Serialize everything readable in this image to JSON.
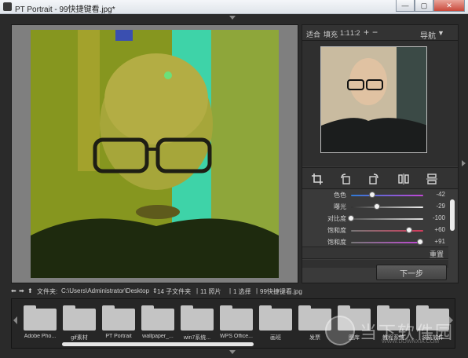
{
  "window": {
    "title": "PT Portrait - 99快捷键看.jpg*",
    "minimize_icon": "minimize-icon",
    "maximize_icon": "maximize-icon",
    "close_icon": "close-icon"
  },
  "zoom_bar": {
    "fit": "适合",
    "fill": "填充",
    "ratio1": "1:1",
    "ratio2": "1:2",
    "plus": "+",
    "minus": "−",
    "nav_label": "导航",
    "nav_toggle": "▼"
  },
  "tools": [
    "crop-icon",
    "rotate-left-icon",
    "rotate-right-icon",
    "flip-horizontal-icon",
    "flip-vertical-icon"
  ],
  "sliders": [
    {
      "label": "色色",
      "value": "-42",
      "fraction": 0.29,
      "track": "linear-gradient(90deg,#2e7bd6,#c247d6)"
    },
    {
      "label": "曝光",
      "value": "-29",
      "fraction": 0.36,
      "track": "linear-gradient(90deg,#333,#eee)"
    },
    {
      "label": "对比度",
      "value": "-100",
      "fraction": 0.0,
      "track": "linear-gradient(90deg,#555,#ddd)"
    },
    {
      "label": "饱和度",
      "value": "+60",
      "fraction": 0.8,
      "track": "linear-gradient(90deg,#777,#d33b5c)"
    },
    {
      "label": "饱和度",
      "value": "+91",
      "fraction": 0.955,
      "track": "linear-gradient(90deg,#777,#c247d6)"
    }
  ],
  "reset_label": "重置",
  "next_button": "下一步",
  "pathbar": {
    "folder_label": "文件夹:",
    "path": "C:\\Users\\Administrator\\Desktop",
    "sub_folders": "14 子文件夹",
    "photos": "11 照片",
    "selected": "1 选择",
    "file": "99快捷键看.jpg"
  },
  "folders": [
    {
      "name": "Adobe Pho..."
    },
    {
      "name": "gif素材"
    },
    {
      "name": "PT Portrait"
    },
    {
      "name": "wallpaper_..."
    },
    {
      "name": "win7系统..."
    },
    {
      "name": "WPS Office..."
    },
    {
      "name": "画班"
    },
    {
      "name": "发票"
    },
    {
      "name": "图库"
    },
    {
      "name": "教程系统"
    },
    {
      "name": "装载软件"
    }
  ],
  "watermark": {
    "text": "当下软件园",
    "url": "WWW.DOWNXIA.COM"
  },
  "colors": {
    "panel_bg": "#3a3a3a",
    "viewer_bg": "#7f7f7f",
    "tint_green": "#9fb43a",
    "tint_cyan": "#2fd0a0"
  }
}
